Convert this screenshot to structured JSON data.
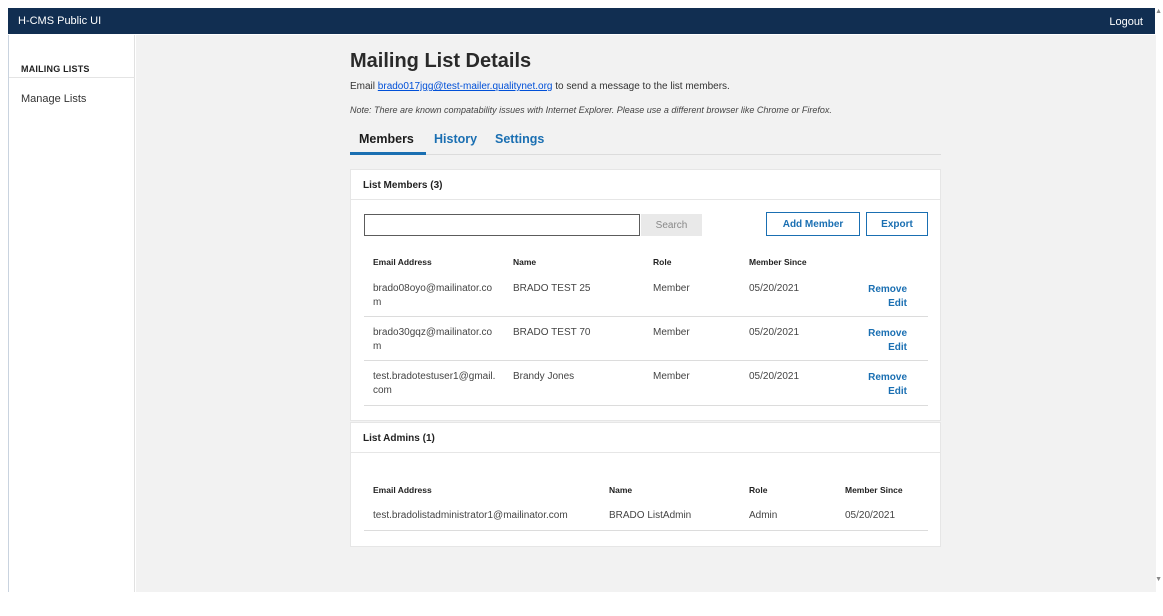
{
  "app": {
    "title": "H-CMS Public UI",
    "logout_label": "Logout"
  },
  "sidebar": {
    "heading": "MAILING LISTS",
    "items": [
      {
        "label": "Manage Lists"
      }
    ]
  },
  "page": {
    "title": "Mailing List Details",
    "intro_prefix": "Email ",
    "list_email": "brado017jgg@test-mailer.qualitynet.org",
    "intro_suffix": " to send a message to the list members.",
    "note": "Note: There are known compatability issues with Internet Explorer. Please use a different browser like Chrome or Firefox."
  },
  "tabs": [
    {
      "label": "Members",
      "active": true
    },
    {
      "label": "History",
      "active": false
    },
    {
      "label": "Settings",
      "active": false
    }
  ],
  "members": {
    "heading": "List Members (3)",
    "search": {
      "value": "",
      "placeholder": "",
      "button_label": "Search"
    },
    "add_button_label": "Add Member",
    "export_button_label": "Export",
    "columns": [
      "Email Address",
      "Name",
      "Role",
      "Member Since"
    ],
    "rows": [
      {
        "email": "brado08oyo@mailinator.com",
        "name": "BRADO TEST 25",
        "role": "Member",
        "since": "05/20/2021",
        "remove": "Remove",
        "edit": "Edit"
      },
      {
        "email": "brado30gqz@mailinator.com",
        "name": "BRADO TEST 70",
        "role": "Member",
        "since": "05/20/2021",
        "remove": "Remove",
        "edit": "Edit"
      },
      {
        "email": "test.bradotestuser1@gmail.com",
        "name": "Brandy Jones",
        "role": "Member",
        "since": "05/20/2021",
        "remove": "Remove",
        "edit": "Edit"
      }
    ]
  },
  "admins": {
    "heading": "List Admins (1)",
    "columns": [
      "Email Address",
      "Name",
      "Role",
      "Member Since"
    ],
    "rows": [
      {
        "email": "test.bradolistadministrator1@mailinator.com",
        "name": "BRADO ListAdmin",
        "role": "Admin",
        "since": "05/20/2021"
      }
    ]
  },
  "colors": {
    "header_bg": "#112e51",
    "link": "#1a6fb2",
    "page_bg": "#f2f2f2"
  }
}
